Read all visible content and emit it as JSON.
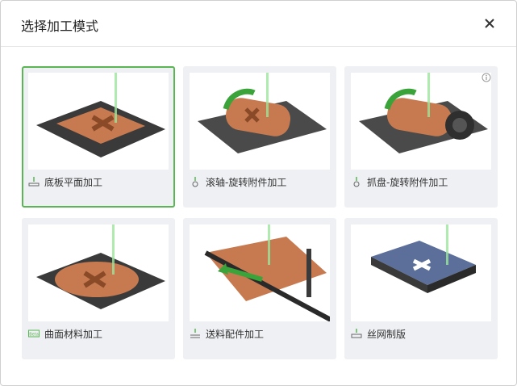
{
  "dialog": {
    "title": "选择加工模式",
    "close_icon": "close-icon"
  },
  "modes": [
    {
      "label": "底板平面加工",
      "icon": "laser-plane-icon",
      "selected": true
    },
    {
      "label": "滚轴-旋转附件加工",
      "icon": "laser-rotary-icon",
      "selected": false
    },
    {
      "label": "抓盘-旋转附件加工",
      "icon": "laser-rotary-icon",
      "selected": false,
      "info_icon": "info-icon"
    },
    {
      "label": "曲面材料加工",
      "icon": "beta-badge-icon",
      "badge": "Beta",
      "selected": false
    },
    {
      "label": "送料配件加工",
      "icon": "laser-feeder-icon",
      "selected": false
    },
    {
      "label": "丝网制版",
      "icon": "laser-screen-icon",
      "selected": false
    }
  ],
  "colors": {
    "accent": "#5ab653",
    "card_bg": "#eef0f3",
    "laser": "#7dd87a"
  }
}
